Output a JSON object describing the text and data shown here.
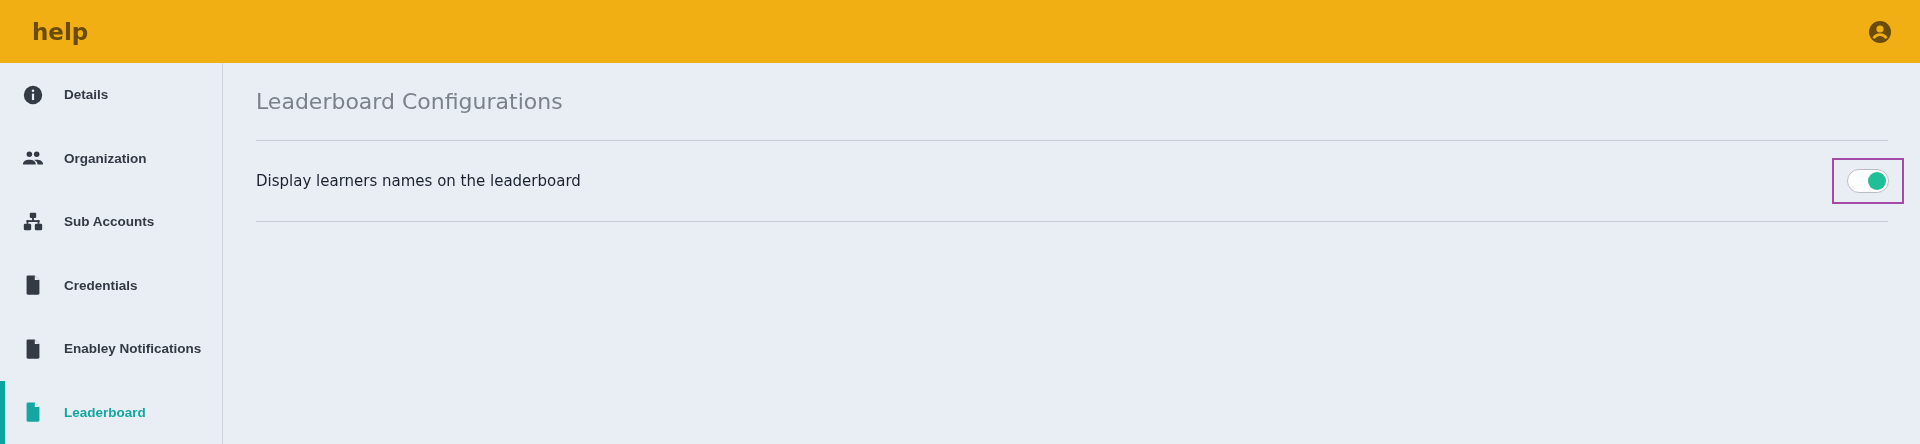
{
  "header": {
    "title": "help"
  },
  "sidebar": {
    "items": [
      {
        "label": "Details",
        "kind": "info",
        "selected": false
      },
      {
        "label": "Organization",
        "kind": "people",
        "selected": false
      },
      {
        "label": "Sub Accounts",
        "kind": "sitemap",
        "selected": false
      },
      {
        "label": "Credentials",
        "kind": "file",
        "selected": false
      },
      {
        "label": "Enabley Notifications",
        "kind": "file",
        "selected": false
      },
      {
        "label": "Leaderboard",
        "kind": "file",
        "selected": true
      }
    ]
  },
  "main": {
    "title": "Leaderboard Configurations",
    "settings": [
      {
        "label": "Display learners names on the leaderboard",
        "on": true,
        "focused": true
      }
    ]
  }
}
